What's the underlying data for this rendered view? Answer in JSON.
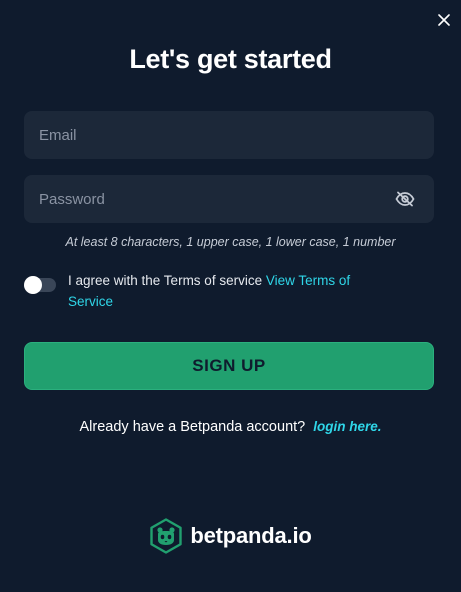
{
  "modal": {
    "title": "Let's get started"
  },
  "form": {
    "email_placeholder": "Email",
    "password_placeholder": "Password",
    "password_hint": "At least 8 characters, 1 upper case, 1 lower case, 1 number",
    "terms_text": "I agree with the Terms of service ",
    "terms_link": "View Terms of Service",
    "terms_agreed": false,
    "signup_label": "SIGN UP"
  },
  "login": {
    "prompt": "Already have a Betpanda account?",
    "link": "login here."
  },
  "brand": {
    "name": "betpanda.io"
  },
  "icons": {
    "close": "close-icon",
    "eye": "eye-off-icon",
    "logo": "panda-logo-icon"
  },
  "colors": {
    "background": "#0f1b2d",
    "field": "#1c2839",
    "accent_green": "#21a06f",
    "link_cyan": "#2fd6e8"
  }
}
